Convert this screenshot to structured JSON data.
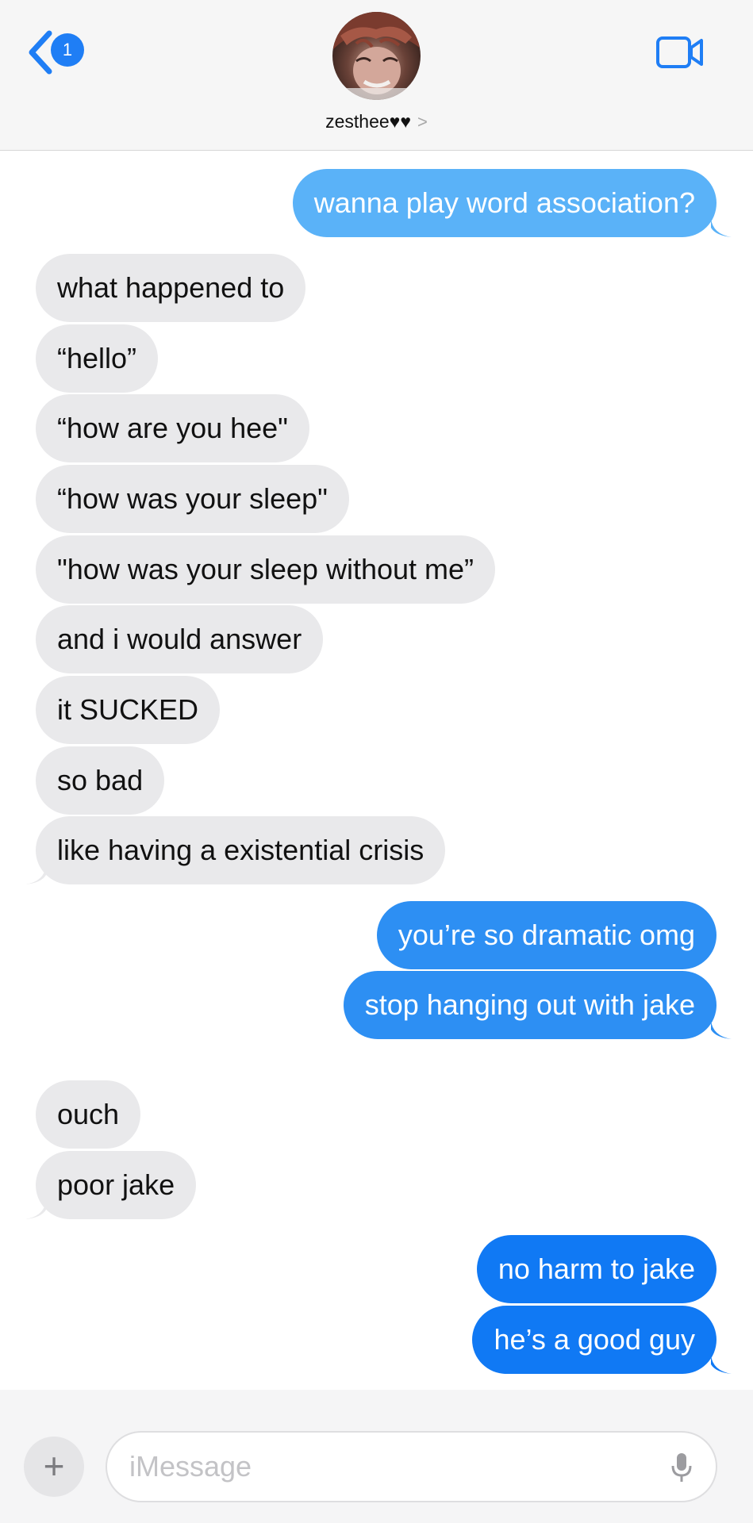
{
  "header": {
    "back_badge_count": "1",
    "contact_name": "zesthee♥♥",
    "contact_chevron": ">"
  },
  "messages": [
    {
      "from": "me",
      "text": "wanna play word association?"
    },
    {
      "from": "them",
      "text": "what happened to"
    },
    {
      "from": "them",
      "text": "“hello”"
    },
    {
      "from": "them",
      "text": "“how are you hee\""
    },
    {
      "from": "them",
      "text": "“how was your sleep\""
    },
    {
      "from": "them",
      "text": "\"how was your sleep without me”"
    },
    {
      "from": "them",
      "text": "and i would answer"
    },
    {
      "from": "them",
      "text": "it SUCKED"
    },
    {
      "from": "them",
      "text": "so bad"
    },
    {
      "from": "them",
      "text": "like having a existential crisis"
    },
    {
      "from": "me",
      "text": "you’re so dramatic omg"
    },
    {
      "from": "me",
      "text": "stop hanging out with jake"
    },
    {
      "from": "them",
      "text": "ouch"
    },
    {
      "from": "them",
      "text": "poor jake"
    },
    {
      "from": "me",
      "text": "no harm to jake"
    },
    {
      "from": "me",
      "text": "he’s a good guy"
    }
  ],
  "composer": {
    "placeholder": "iMessage",
    "plus_label": "+"
  },
  "colors": {
    "accent": "#1f7ef5",
    "incoming_bubble": "#e9e9eb",
    "outgoing_bubble_light": "#5ab2f8",
    "outgoing_bubble": "#1079f4"
  }
}
